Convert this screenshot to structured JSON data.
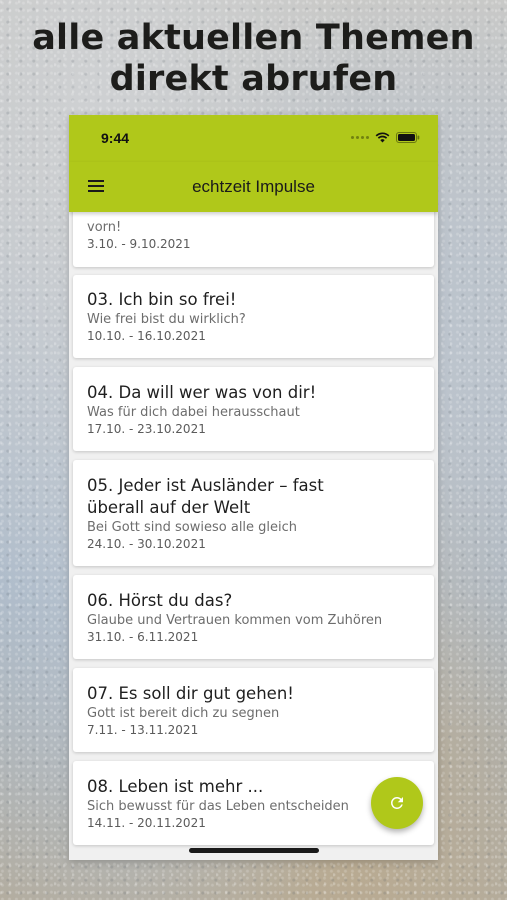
{
  "headline": {
    "line1": "alle aktuellen Themen",
    "line2": "direkt abrufen"
  },
  "status_bar": {
    "time": "9:44",
    "icons": [
      "signal-dots-icon",
      "wifi-icon",
      "battery-icon"
    ]
  },
  "app_bar": {
    "title": "echtzeit Impulse",
    "menu_icon": "hamburger-menu-icon"
  },
  "items": [
    {
      "title": "",
      "subtitle": "vorn!",
      "date": "3.10. - 9.10.2021"
    },
    {
      "title": "03. Ich bin so frei!",
      "subtitle": "Wie frei bist du wirklich?",
      "date": "10.10. - 16.10.2021"
    },
    {
      "title": "04. Da will wer was von dir!",
      "subtitle": "Was für dich dabei herausschaut",
      "date": "17.10. - 23.10.2021"
    },
    {
      "title_line1": "05. Jeder ist Ausländer – fast",
      "title_line2": "überall auf der Welt",
      "subtitle": "Bei Gott sind sowieso alle gleich",
      "date": "24.10. - 30.10.2021"
    },
    {
      "title": "06. Hörst du das?",
      "subtitle": "Glaube und Vertrauen kommen vom Zuhören",
      "date": "31.10. - 6.11.2021"
    },
    {
      "title": "07. Es soll dir gut gehen!",
      "subtitle": "Gott ist bereit dich zu segnen",
      "date": "7.11. - 13.11.2021"
    },
    {
      "title": "08. Leben ist mehr ...",
      "subtitle": "Sich bewusst für das Leben entscheiden",
      "date": "14.11. - 20.11.2021"
    }
  ],
  "fab": {
    "icon": "refresh-icon"
  },
  "colors": {
    "accent": "#b0c81a",
    "text_primary": "#1f1f1f",
    "text_secondary": "#6d6d6d"
  }
}
